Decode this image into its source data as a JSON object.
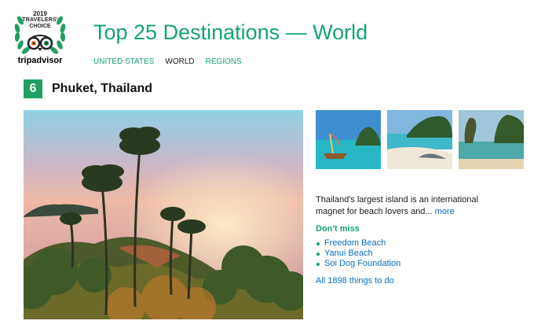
{
  "badge": {
    "year": "2019",
    "line1": "TRAVELERS'",
    "line2": "CHOICE",
    "brand": "tripadvisor"
  },
  "header": {
    "title": "Top 25 Destinations — World"
  },
  "nav": {
    "items": [
      "UNITED STATES",
      "WORLD",
      "REGIONS"
    ],
    "active": "WORLD"
  },
  "destination": {
    "rank": "6",
    "name": "Phuket, Thailand",
    "description": "Thailand's largest island is an international magnet for beach lovers and...",
    "more_label": "more",
    "dont_miss_label": "Don't miss",
    "attractions": [
      "Freedom Beach",
      "Yanui Beach",
      "Soi Dog Foundation"
    ],
    "all_things_label": "All 1898 things to do"
  },
  "colors": {
    "brand_green": "#14a46e",
    "rank_badge": "#1f9f62",
    "link_blue": "#0a6ebd"
  }
}
